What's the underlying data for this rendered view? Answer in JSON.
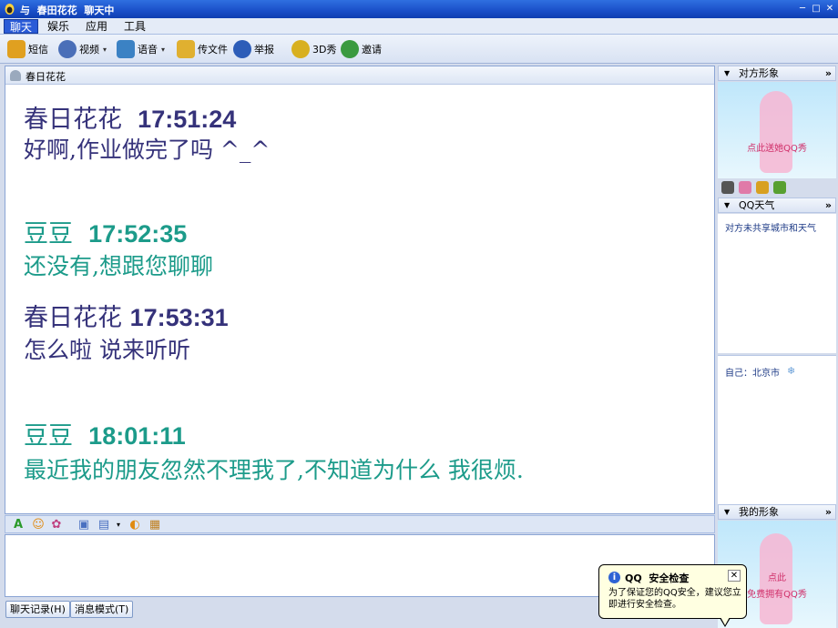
{
  "window": {
    "title": "与  春田花花  聊天中",
    "minimize_glyph": "─",
    "maximize_glyph": "□",
    "close_glyph": "✕"
  },
  "menu": {
    "items": [
      "聊天",
      "娱乐",
      "应用",
      "工具"
    ]
  },
  "toolbar": {
    "items": [
      {
        "label": "短信",
        "icon": "sms-icon",
        "color": "#e0a020"
      },
      {
        "label": "视频",
        "icon": "webcam-icon",
        "color": "#4a6fb8"
      },
      {
        "label": "语音",
        "icon": "voice-icon",
        "color": "#3b82c4"
      },
      {
        "label": "传文件",
        "icon": "file-transfer-icon",
        "color": "#e0b030"
      },
      {
        "label": "举报",
        "icon": "report-icon",
        "color": "#2d5db8"
      },
      {
        "label": "3D秀",
        "icon": "3d-show-icon",
        "color": "#d8b020"
      },
      {
        "label": "邀请",
        "icon": "invite-icon",
        "color": "#3a9a40"
      }
    ]
  },
  "chat": {
    "contact_name": "春日花花",
    "messages": [
      {
        "sender": "春日花花  ",
        "time": "17:51:24",
        "text": "好啊,作业做完了吗 ^_^",
        "who": "them"
      },
      {
        "sender": "豆豆  ",
        "time": "17:52:35",
        "text": "还没有,想跟您聊聊",
        "who": "me"
      },
      {
        "sender": "春日花花 ",
        "time": "17:53:31",
        "text": "怎么啦 说来听听",
        "who": "them"
      },
      {
        "sender": "豆豆  ",
        "time": "18:01:11",
        "text": "最近我的朋友忽然不理我了,不知道为什么 我很烦.",
        "who": "me"
      }
    ],
    "colors": {
      "them": "#35327a",
      "me": "#1c9b8a"
    }
  },
  "format_toolbar": {
    "icons": [
      "font-icon",
      "emoticon-icon",
      "magic-icon",
      "screenshot-icon",
      "image-icon",
      "scribble-icon",
      "scene-icon"
    ]
  },
  "bottom": {
    "history_button": "聊天记录(H)",
    "mode_button": "消息模式(T)"
  },
  "right_panel": {
    "peer_show": {
      "header": "对方形象",
      "link": "点此送她QQ秀"
    },
    "weather": {
      "header": "QQ天气",
      "peer_text": "对方未共享城市和天气",
      "self_text": "自己：北京市"
    },
    "my_show": {
      "header": "我的形象",
      "link_line1": "点此",
      "link_line2": "免费拥有QQ秀"
    },
    "more_glyph": "»"
  },
  "tooltip": {
    "title": "QQ  安全检查",
    "body": "为了保证您的QQ安全，建议您立即进行安全检查。",
    "close_glyph": "✕"
  }
}
